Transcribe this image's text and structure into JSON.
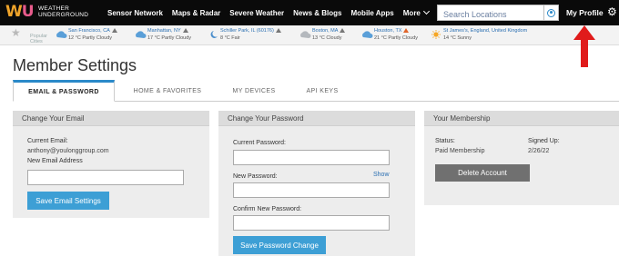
{
  "brand": {
    "logo_line1": "Weather",
    "logo_line2": "Underground"
  },
  "nav": {
    "items": [
      "Sensor Network",
      "Maps & Radar",
      "Severe Weather",
      "News & Blogs",
      "Mobile Apps",
      "More"
    ],
    "search_placeholder": "Search Locations",
    "profile_label": "My Profile"
  },
  "cities": {
    "label": "Popular Cities",
    "items": [
      {
        "name": "San Francisco, CA",
        "cond": "12 °C Partly Cloudy",
        "icon": "partly-cloudy-night-icon"
      },
      {
        "name": "Manhattan, NY",
        "cond": "17 °C Partly Cloudy",
        "icon": "partly-cloudy-night-icon"
      },
      {
        "name": "Schiller Park, IL (60176)",
        "cond": "8 °C Fair",
        "icon": "clear-night-icon"
      },
      {
        "name": "Boston, MA",
        "cond": "13 °C Cloudy",
        "icon": "cloudy-icon"
      },
      {
        "name": "Houston, TX",
        "cond": "21 °C Partly Cloudy",
        "icon": "partly-cloudy-night-icon"
      },
      {
        "name": "St James's, England, United Kingdom",
        "cond": "14 °C Sunny",
        "icon": "sunny-icon"
      }
    ]
  },
  "page": {
    "title": "Member Settings",
    "tabs": [
      "EMAIL & PASSWORD",
      "HOME & FAVORITES",
      "MY DEVICES",
      "API KEYS"
    ]
  },
  "email_panel": {
    "heading": "Change Your Email",
    "current_label": "Current Email:",
    "current_value": "anthony@youlonggroup.com",
    "new_label": "New Email Address",
    "new_value": "",
    "button": "Save Email Settings"
  },
  "password_panel": {
    "heading": "Change Your Password",
    "current_label": "Current Password:",
    "new_label": "New Password:",
    "show_label": "Show",
    "confirm_label": "Confirm New Password:",
    "button": "Save Password Change"
  },
  "membership_panel": {
    "heading": "Your Membership",
    "status_label": "Status:",
    "status_value": "Paid Membership",
    "signed_label": "Signed Up:",
    "signed_value": "2/26/22",
    "button": "Delete Account"
  },
  "colors": {
    "accent": "#3d9fd5",
    "nav_bg": "#0a0a0a",
    "annotation_arrow": "#e01b1b"
  }
}
